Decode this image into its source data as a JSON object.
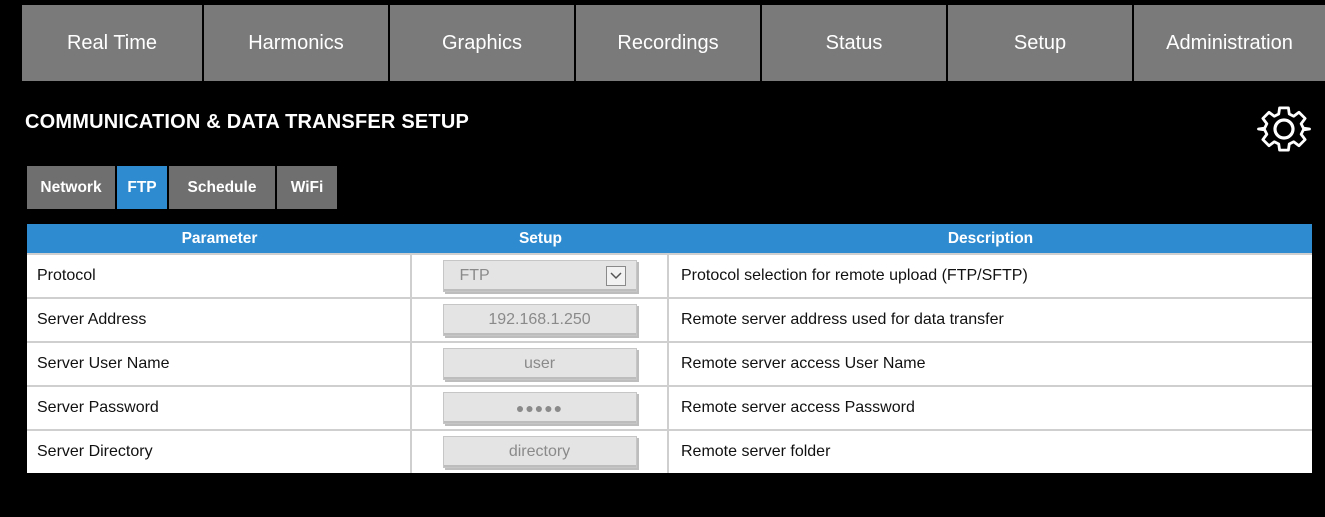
{
  "nav": {
    "items": [
      {
        "label": "Real Time"
      },
      {
        "label": "Harmonics"
      },
      {
        "label": "Graphics"
      },
      {
        "label": "Recordings"
      },
      {
        "label": "Status"
      },
      {
        "label": "Setup"
      },
      {
        "label": "Administration"
      }
    ]
  },
  "page": {
    "title": "COMMUNICATION & DATA TRANSFER SETUP",
    "settings_icon": "gear-icon"
  },
  "subtabs": {
    "active": "FTP",
    "items": [
      {
        "label": "Network"
      },
      {
        "label": "FTP"
      },
      {
        "label": "Schedule"
      },
      {
        "label": "WiFi"
      }
    ]
  },
  "table": {
    "headers": {
      "parameter": "Parameter",
      "setup": "Setup",
      "description": "Description"
    },
    "rows": [
      {
        "parameter": "Protocol",
        "value": "FTP",
        "description": "Protocol selection for remote upload (FTP/SFTP)"
      },
      {
        "parameter": "Server Address",
        "value": "192.168.1.250",
        "description": "Remote server address used for data transfer"
      },
      {
        "parameter": "Server User Name",
        "value": "user",
        "description": "Remote server access User Name"
      },
      {
        "parameter": "Server Password",
        "value": "●●●●●",
        "description": "Remote server access Password"
      },
      {
        "parameter": "Server Directory",
        "value": "directory",
        "description": "Remote server folder"
      }
    ]
  },
  "colors": {
    "background": "#000000",
    "nav_gray": "#7a7a7a",
    "accent_blue": "#2f8bd0",
    "field_gray": "#e4e4e4"
  }
}
